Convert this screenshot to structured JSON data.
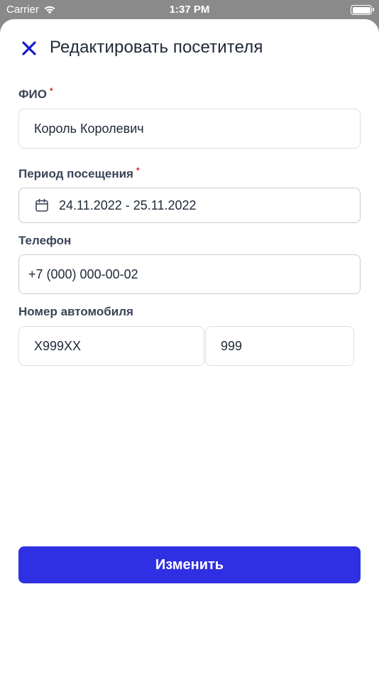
{
  "status_bar": {
    "carrier": "Carrier",
    "time": "1:37 PM"
  },
  "header": {
    "title": "Редактировать посетителя",
    "close_icon": "close-icon"
  },
  "form": {
    "fio": {
      "label": "ФИО",
      "required_mark": "*",
      "value": "Король Королевич"
    },
    "period": {
      "label": "Период посещения",
      "required_mark": "*",
      "value": "24.11.2022 - 25.11.2022",
      "icon": "calendar-icon"
    },
    "phone": {
      "label": "Телефон",
      "value": "+7 (000) 000-00-02"
    },
    "car_number": {
      "label": "Номер автомобиля",
      "plate_value": "Х999ХХ",
      "region_value": "999"
    }
  },
  "submit_label": "Изменить",
  "colors": {
    "accent": "#2f2fe3",
    "close_icon": "#1a1ad1",
    "required": "#e11d2e",
    "label": "#3a4458"
  }
}
